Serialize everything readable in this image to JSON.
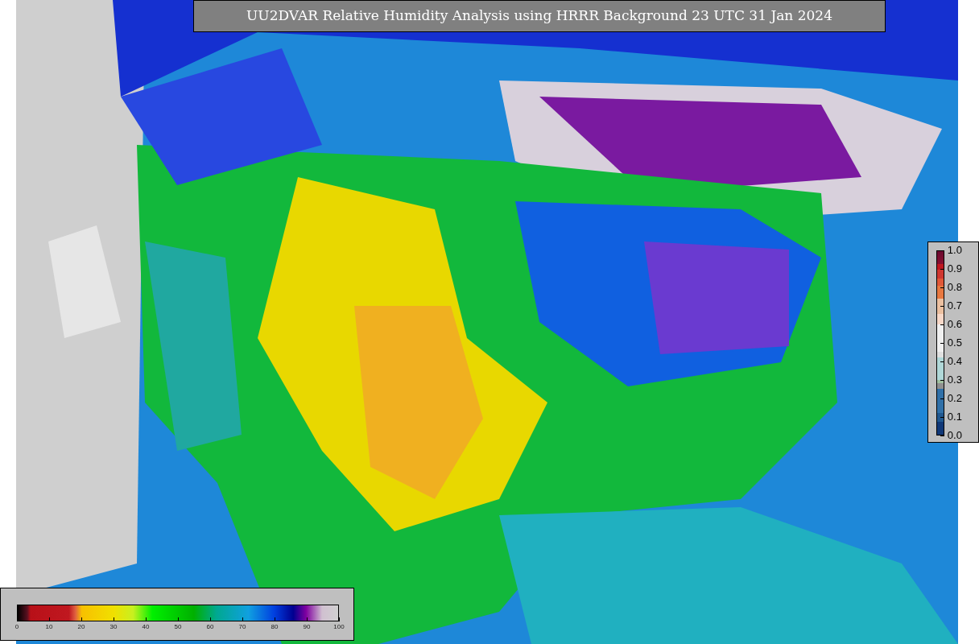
{
  "title": "UU2DVAR Relative Humidity Analysis using HRRR Background 23 UTC 31 Jan 2024",
  "humidity_colorbar": {
    "ticks": [
      "0",
      "10",
      "20",
      "30",
      "40",
      "50",
      "60",
      "70",
      "80",
      "90",
      "100"
    ]
  },
  "ratio_colorbar": {
    "ticks": [
      "1.0",
      "0.9",
      "0.8",
      "0.7",
      "0.6",
      "0.5",
      "0.4",
      "0.3",
      "0.2",
      "0.1",
      "0.0"
    ]
  }
}
